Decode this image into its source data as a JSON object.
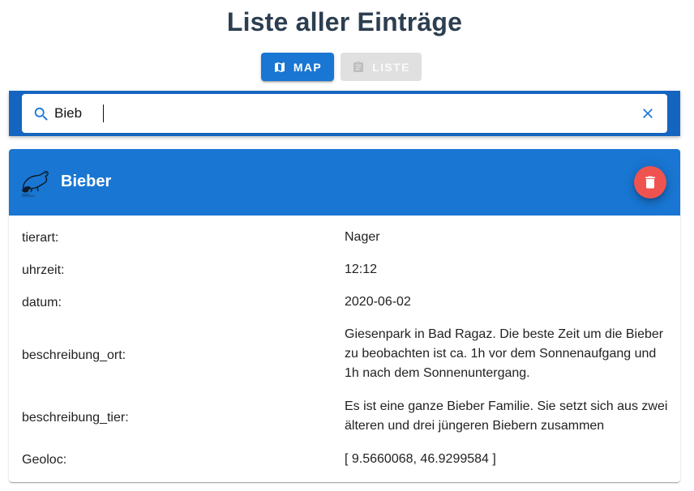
{
  "page": {
    "title": "Liste aller Einträge"
  },
  "toolbar": {
    "map_label": "Map",
    "liste_label": "Liste"
  },
  "search": {
    "value": "Bieb",
    "placeholder": ""
  },
  "entry": {
    "name": "Bieber",
    "fields": [
      {
        "label": "tierart:",
        "value": "Nager"
      },
      {
        "label": "uhrzeit:",
        "value": "12:12"
      },
      {
        "label": "datum:",
        "value": "2020-06-02"
      },
      {
        "label": "beschreibung_ort:",
        "value": "Giesenpark in Bad Ragaz. Die beste Zeit um die Bieber zu beobachten ist ca. 1h vor dem Sonnenaufgang und 1h nach dem Sonnenuntergang."
      },
      {
        "label": "beschreibung_tier:",
        "value": "Es ist eine ganze Bieber Familie. Sie setzt sich aus zwei älteren und drei jüngeren Biebern zusammen"
      },
      {
        "label": "Geoloc:",
        "value": "[ 9.5660068, 46.9299584 ]"
      }
    ]
  },
  "icons": {
    "map": "map-icon",
    "liste": "clipboard-icon",
    "search": "search-icon",
    "clear": "close-icon",
    "entry": "beaver-icon",
    "delete": "trash-icon"
  },
  "colors": {
    "primary": "#1976d2",
    "search_bar": "#1565c0",
    "delete": "#ef5350",
    "disabled": "#e0e0e0",
    "title": "#2c3e50"
  }
}
